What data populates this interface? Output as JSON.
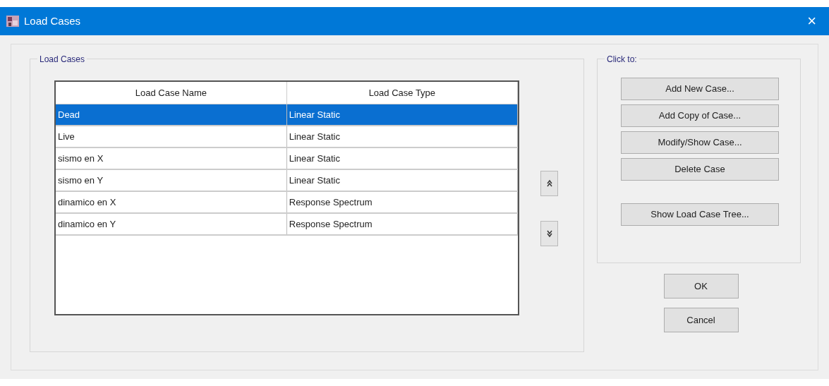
{
  "window": {
    "title": "Load Cases",
    "close": "×"
  },
  "load_cases": {
    "title": "Load Cases",
    "table": {
      "columns": [
        "Load Case Name",
        "Load Case Type"
      ],
      "rows": [
        {
          "cells": [
            "Dead",
            "Linear Static"
          ],
          "selected": true
        },
        {
          "cells": [
            "Live",
            "Linear Static"
          ],
          "selected": false
        },
        {
          "cells": [
            "sismo en X",
            "Linear Static"
          ],
          "selected": false
        },
        {
          "cells": [
            "sismo en Y",
            "Linear Static"
          ],
          "selected": false
        },
        {
          "cells": [
            "dinamico en X",
            "Response Spectrum"
          ],
          "selected": false
        },
        {
          "cells": [
            "dinamico en Y",
            "Response Spectrum"
          ],
          "selected": false
        }
      ]
    },
    "move_buttons": [
      {
        "kind": "up"
      },
      {
        "kind": "down"
      }
    ]
  },
  "click_to": {
    "title": "Click to:",
    "buttons": [
      "Add New Case...",
      "Add Copy of Case...",
      "Modify/Show Case...",
      "Delete Case"
    ],
    "tree_button": "Show Load Case Tree..."
  },
  "dialog_buttons": [
    "OK",
    "Cancel"
  ]
}
